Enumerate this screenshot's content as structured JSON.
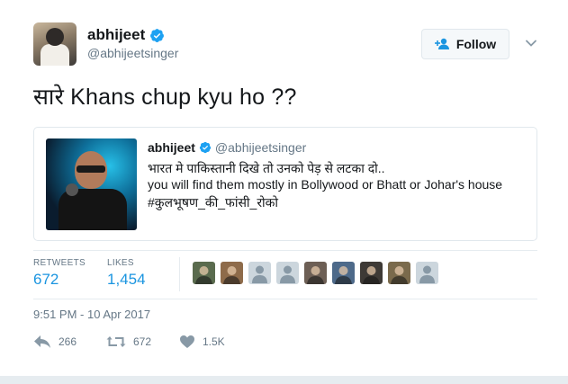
{
  "author": {
    "name": "abhijeet",
    "handle": "@abhijeetsinger",
    "verified": true
  },
  "follow_button": {
    "label": "Follow"
  },
  "tweet": {
    "text": "सारे Khans chup kyu ho ??"
  },
  "quoted_tweet": {
    "name": "abhijeet",
    "handle": "@abhijeetsinger",
    "lines": [
      "भारत मे पाकिस्तानी दिखे तो उनको पेड़ से लटका दो..",
      "you will find them mostly in Bollywood or Bhatt or Johar's house",
      "#कुलभूषण_की_फांसी_रोको"
    ]
  },
  "stats": {
    "retweets_label": "RETWEETS",
    "retweets_value": "672",
    "likes_label": "LIKES",
    "likes_value": "1,454"
  },
  "likers": [
    {
      "kind": "photo",
      "color": "#5a6b4e"
    },
    {
      "kind": "photo",
      "color": "#8e6b4a"
    },
    {
      "kind": "default",
      "color": "#ccd6dd"
    },
    {
      "kind": "default",
      "color": "#ccd6dd"
    },
    {
      "kind": "photo",
      "color": "#6d5f55"
    },
    {
      "kind": "photo",
      "color": "#4e6a8a"
    },
    {
      "kind": "photo",
      "color": "#3e3a36"
    },
    {
      "kind": "photo",
      "color": "#7a6a4c"
    },
    {
      "kind": "default",
      "color": "#ccd6dd"
    }
  ],
  "timestamp": "9:51 PM - 10 Apr 2017",
  "actions": {
    "reply_count": "266",
    "retweet_count": "672",
    "like_count": "1.5K"
  },
  "colors": {
    "accent": "#1b95e0",
    "text_primary": "#14171a",
    "text_secondary": "#657786",
    "border": "#e1e8ed"
  },
  "icons": {
    "verified": "verified-badge-icon",
    "follow": "add-user-icon",
    "chevron": "chevron-down-icon",
    "reply": "reply-icon",
    "retweet": "retweet-icon",
    "like": "heart-icon"
  }
}
